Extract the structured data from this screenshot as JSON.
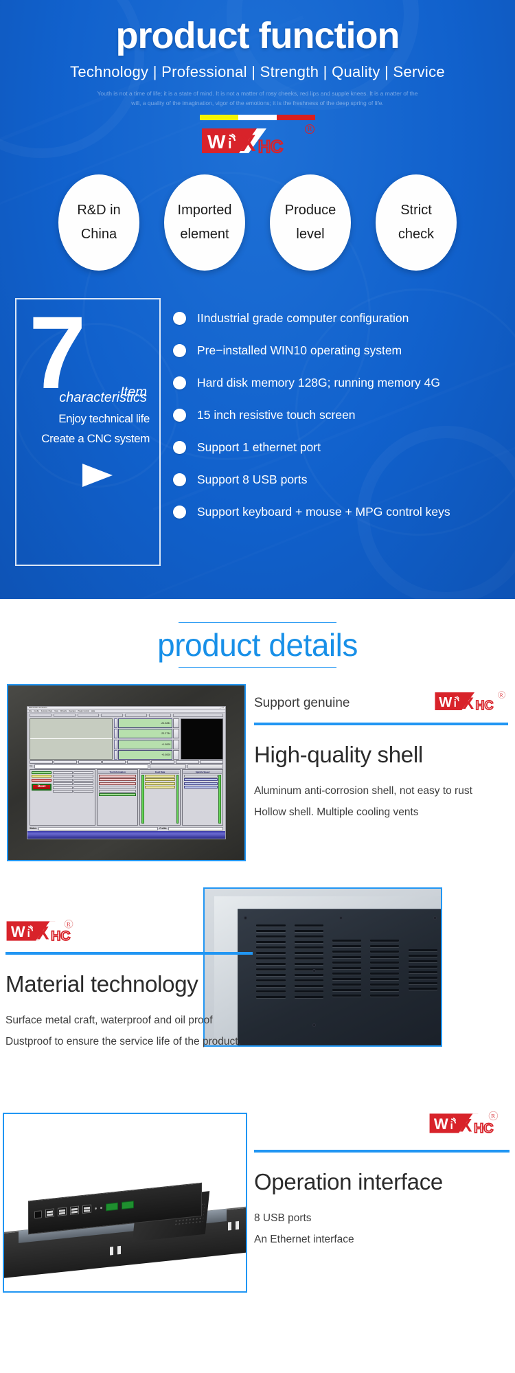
{
  "colors": {
    "hero_blue": "#1163cf",
    "accent_blue": "#2196f3",
    "title_blue": "#1890e8",
    "logo_red": "#d8232a",
    "bar_yellow": "#f5f500",
    "bar_white": "#ffffff",
    "bar_red": "#d81f1f"
  },
  "hero": {
    "title": "product function",
    "subtitle": "Technology | Professional | Strength | Quality | Service",
    "quote": "Youth is not a time of life; it is a state of mind. It is not a matter of rosy cheeks, red lips and supple knees. It is a matter of the will, a quality of the imagination, vigor of the emotions; it is the freshness of the deep spring of life.",
    "accent_bar": [
      "yellow",
      "white",
      "red"
    ],
    "logo": {
      "w": "W",
      "i": "i",
      "x": "X",
      "hc": "HC",
      "registered": "R"
    },
    "circles": [
      {
        "line1": "R&D in",
        "line2": "China"
      },
      {
        "line1": "Imported",
        "line2": "element"
      },
      {
        "line1": "Produce",
        "line2": "level"
      },
      {
        "line1": "Strict",
        "line2": "check"
      }
    ],
    "feature_panel": {
      "number": "7",
      "italic_line1": "Item",
      "italic_line2": "characteristics",
      "tagline1": "Enjoy technical life",
      "tagline2": "Create a CNC system"
    },
    "bullets": [
      "IIndustrial grade computer configuration",
      "Pre−installed WIN10 operating system",
      "Hard disk memory 128G; running memory 4G",
      "15 inch resistive touch screen",
      "Support 1 ethernet port",
      "Support 8 USB ports",
      "Support keyboard + mouse + MPG control keys"
    ]
  },
  "details": {
    "section_title": "product details",
    "blocks": [
      {
        "support_label": "Support genuine",
        "title": "High-quality shell",
        "body_line1": "Aluminum anti-corrosion shell, not easy to rust",
        "body_line2": "Hollow shell. Multiple cooling vents",
        "photo": "cnc-touch-screen-front-photo"
      },
      {
        "support_label": "",
        "title": "Material technology",
        "body_line1": "Surface metal craft, waterproof and oil proof",
        "body_line2": "Dustproof to ensure the service life of the product.",
        "photo": "back-panel-vents-photo"
      },
      {
        "support_label": "",
        "title": "Operation interface",
        "body_line1": "8 USB ports",
        "body_line2": "An Ethernet interface",
        "photo": "chassis-io-ports-photo"
      }
    ]
  },
  "cnc_screen": {
    "dro_values": [
      "-24.3281",
      "-23.2734",
      "+1.0000",
      "+0.0000"
    ],
    "axis_labels": [
      "X",
      "Y",
      "Z",
      "4"
    ],
    "panel_titles": [
      "Tool Information",
      "Feed Rate",
      "Spindle Speed"
    ],
    "reset_label": "Reset",
    "status_label": "Status:",
    "profile_label": "Profile:",
    "file_label": "File:",
    "tool_fields": [
      {
        "label": "Tool",
        "value": "0"
      },
      {
        "label": "Dia",
        "value": "+0.0000"
      },
      {
        "label": "H",
        "value": "+0.0000"
      }
    ],
    "feed_fields": [
      {
        "label": "FRO",
        "value": "3000.00"
      },
      {
        "label": "Feedrate",
        "value": "3000.00"
      },
      {
        "label": "Units/Min",
        "value": "0.00"
      },
      {
        "label": "Units/Rev",
        "value": "0.00"
      }
    ],
    "spindle_fields": [
      {
        "label": "RPM",
        "value": "0"
      },
      {
        "label": "S-ov",
        "value": "10000"
      },
      {
        "label": "Spindle Speed",
        "value": "10000"
      }
    ],
    "percent_labels": [
      "100",
      "100"
    ]
  }
}
